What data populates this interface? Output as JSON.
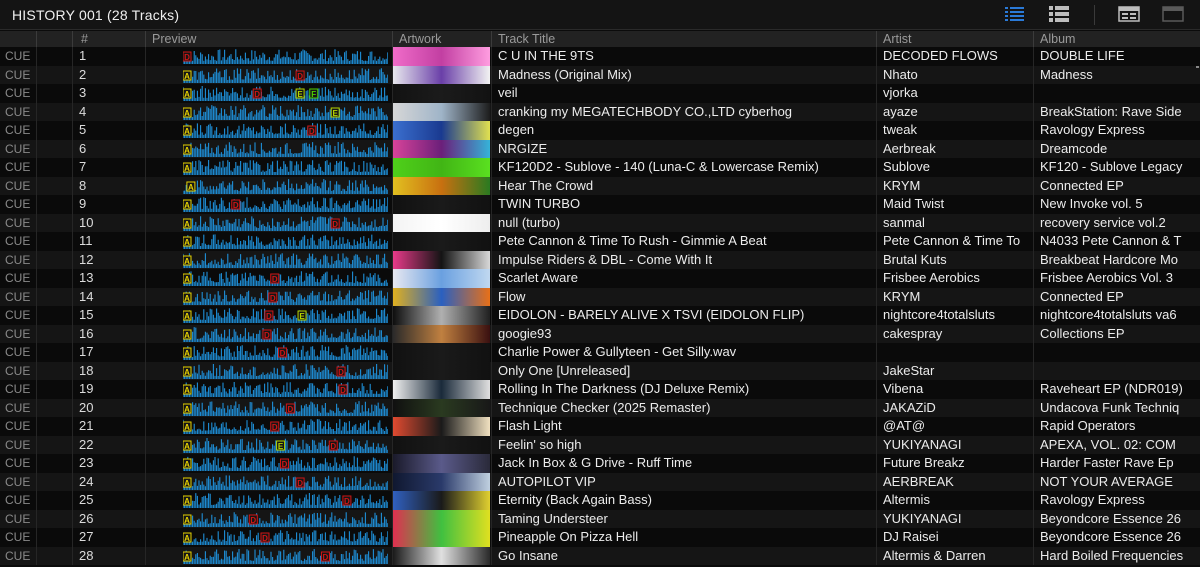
{
  "window": {
    "title": "HISTORY 001 (28 Tracks)"
  },
  "view_buttons": [
    {
      "name": "list-view-icon",
      "active": true
    },
    {
      "name": "detail-list-view-icon",
      "active": false
    },
    {
      "name": "artwork-view-icon",
      "active": false
    },
    {
      "name": "browser-view-icon",
      "active": false
    }
  ],
  "columns": {
    "cue": "",
    "num": "#",
    "preview": "Preview",
    "artwork": "Artwork",
    "title": "Track Title",
    "artist": "Artist",
    "album": "Album"
  },
  "colors": {
    "wave": "#1e8fd8",
    "wave_dim": "#0f4f7d",
    "marker_a": "#e6d200",
    "marker_d": "#d01515",
    "marker_e": "#b6d500",
    "marker_f": "#4ed000"
  },
  "tracks": [
    {
      "cue": "CUE",
      "num": "1",
      "title": "C U IN THE 9TS",
      "artist": "DECODED FLOWS",
      "album": "DOUBLE LIFE",
      "art": [
        "#f06cc9",
        "#c23fa2",
        "#ff9de0"
      ]
    },
    {
      "cue": "CUE",
      "num": "2",
      "title": "Madness  (Original Mix)",
      "artist": "Nhato",
      "album": "Madness",
      "art": [
        "#e8e8ee",
        "#6a3fa8",
        "#f2f2f2"
      ]
    },
    {
      "cue": "CUE",
      "num": "3",
      "title": "veil",
      "artist": "vjorka",
      "album": "",
      "art": [
        "#121212",
        "#1b1b1b",
        "#121212"
      ]
    },
    {
      "cue": "CUE",
      "num": "4",
      "title": "cranking my MEGATECHBODY CO.,LTD cyberhog",
      "artist": "ayaze",
      "album": "BreakStation: Rave Side",
      "art": [
        "#d7d7d7",
        "#9fb4c8",
        "#1d1d1d"
      ]
    },
    {
      "cue": "CUE",
      "num": "5",
      "title": "degen",
      "artist": "tweak",
      "album": "Ravology Express",
      "art": [
        "#3b6fcf",
        "#1a3a90",
        "#e0e050"
      ]
    },
    {
      "cue": "CUE",
      "num": "6",
      "title": "NRGIZE",
      "artist": "Aerbreak",
      "album": "Dreamcode",
      "art": [
        "#d8439a",
        "#6b1f7a",
        "#35b3d9"
      ]
    },
    {
      "cue": "CUE",
      "num": "7",
      "title": "KF120D2 - Sublove - 140 (Luna-C & Lowercase Remix)",
      "artist": "Sublove",
      "album": "KF120 - Sublove Legacy",
      "art": [
        "#4fd01a",
        "#41b515",
        "#5ae020"
      ]
    },
    {
      "cue": "CUE",
      "num": "8",
      "title": "Hear The Crowd",
      "artist": "KRYM",
      "album": "Connected EP",
      "art": [
        "#e2c020",
        "#c87010",
        "#2a7a20"
      ]
    },
    {
      "cue": "CUE",
      "num": "9",
      "title": "TWIN TURBO",
      "artist": "Maid Twist",
      "album": "New Invoke vol. 5",
      "art": [
        "#111111",
        "#1a1a1a",
        "#111111"
      ]
    },
    {
      "cue": "CUE",
      "num": "10",
      "title": "null (turbo)",
      "artist": "sanmal",
      "album": "recovery service vol.2",
      "art": [
        "#f4f4f4",
        "#ffffff",
        "#eeeeee"
      ]
    },
    {
      "cue": "CUE",
      "num": "11",
      "title": "Pete Cannon & Time To Rush - Gimmie A Beat",
      "artist": "Pete Cannon & Time To",
      "album": "N4033 Pete Cannon & T",
      "art": [
        "#111111",
        "#1a1a1a",
        "#111111"
      ]
    },
    {
      "cue": "CUE",
      "num": "12",
      "title": "Impulse Riders & DBL - Come With It",
      "artist": "Brutal Kuts",
      "album": "Breakbeat Hardcore Mo",
      "art": [
        "#e83a8a",
        "#141414",
        "#d8d8d8"
      ]
    },
    {
      "cue": "CUE",
      "num": "13",
      "title": "Scarlet Aware",
      "artist": "Frisbee Aerobics",
      "album": "Frisbee Aerobics Vol. 3",
      "art": [
        "#e8e8f0",
        "#6aa0e0",
        "#c0d8f0"
      ]
    },
    {
      "cue": "CUE",
      "num": "14",
      "title": "Flow",
      "artist": "KRYM",
      "album": "Connected EP",
      "art": [
        "#e0b020",
        "#2a60c0",
        "#e87018"
      ]
    },
    {
      "cue": "CUE",
      "num": "15",
      "title": "EIDOLON - BARELY ALIVE X TSVI (EIDOLON FLIP)",
      "artist": "nightcore4totalsluts",
      "album": "nightcore4totalsluts va6",
      "art": [
        "#0e0e0e",
        "#b0b0b0",
        "#202020"
      ]
    },
    {
      "cue": "CUE",
      "num": "16",
      "title": "googie93",
      "artist": "cakespray",
      "album": "Collections EP",
      "art": [
        "#2a2a2a",
        "#c08040",
        "#3a1010"
      ]
    },
    {
      "cue": "CUE",
      "num": "17",
      "title": "Charlie Power & Gullyteen - Get Silly.wav",
      "artist": "",
      "album": "",
      "art": [
        "#111111",
        "#1a1a1a",
        "#111111"
      ]
    },
    {
      "cue": "CUE",
      "num": "18",
      "title": "Only One [Unreleased]",
      "artist": "JakeStar",
      "album": "",
      "art": [
        "#111111",
        "#1a1a1a",
        "#111111"
      ]
    },
    {
      "cue": "CUE",
      "num": "19",
      "title": "Rolling In The Darkness (DJ Deluxe Remix)",
      "artist": "Vibena",
      "album": "Raveheart EP (NDR019)",
      "art": [
        "#f0f0f0",
        "#1a2a3a",
        "#e0e0e0"
      ]
    },
    {
      "cue": "CUE",
      "num": "20",
      "title": "Technique Checker (2025 Remaster)",
      "artist": "JAKAZiD",
      "album": "Undacova Funk Techniq",
      "art": [
        "#101010",
        "#2a3a20",
        "#181818"
      ]
    },
    {
      "cue": "CUE",
      "num": "21",
      "title": "Flash Light",
      "artist": "@AT@",
      "album": "Rapid Operators",
      "art": [
        "#e04a30",
        "#1a1a1a",
        "#f0e0c0"
      ]
    },
    {
      "cue": "CUE",
      "num": "22",
      "title": "Feelin' so high",
      "artist": "YUKIYANAGI",
      "album": "APEXA, VOL. 02: COM",
      "art": [
        "#111111",
        "#1a1a1a",
        "#111111"
      ]
    },
    {
      "cue": "CUE",
      "num": "23",
      "title": "Jack In Box & G Drive - Ruff Time",
      "artist": "Future Breakz",
      "album": "Harder Faster Rave Ep",
      "art": [
        "#1a1a2a",
        "#5a5a8a",
        "#2a2a3a"
      ]
    },
    {
      "cue": "CUE",
      "num": "24",
      "title": "AUTOPILOT VIP",
      "artist": "AERBREAK",
      "album": "NOT YOUR AVERAGE",
      "art": [
        "#101830",
        "#2a3a6a",
        "#c0d0e0"
      ]
    },
    {
      "cue": "CUE",
      "num": "25",
      "title": "Eternity (Back Again Bass)",
      "artist": "Altermis",
      "album": "Ravology Express",
      "art": [
        "#3060c0",
        "#1a1a1a",
        "#e0d030"
      ]
    },
    {
      "cue": "CUE",
      "num": "26",
      "title": "Taming Understeer",
      "artist": "YUKIYANAGI",
      "album": "Beyondcore Essence 26",
      "art": [
        "#e03050",
        "#40c040",
        "#e0e020"
      ]
    },
    {
      "cue": "CUE",
      "num": "27",
      "title": "Pineapple On Pizza Hell",
      "artist": "DJ Raisei",
      "album": "Beyondcore Essence 26",
      "art": [
        "#e03050",
        "#40c040",
        "#e0e020"
      ]
    },
    {
      "cue": "CUE",
      "num": "28",
      "title": "Go Insane",
      "artist": "Altermis & Darren",
      "album": "Hard Boiled Frequencies",
      "art": [
        "#1a1a1a",
        "#e0e0e0",
        "#2a2a2a"
      ]
    }
  ],
  "markers": [
    [
      [
        "A",
        0.0
      ],
      [
        "D",
        0.0
      ]
    ],
    [
      [
        "A",
        0.0
      ],
      [
        "D",
        0.58
      ]
    ],
    [
      [
        "A",
        0.0
      ],
      [
        "D",
        0.36
      ],
      [
        "E",
        0.58
      ],
      [
        "F",
        0.65
      ]
    ],
    [
      [
        "A",
        0.0
      ],
      [
        "E",
        0.76
      ]
    ],
    [
      [
        "A",
        0.0
      ],
      [
        "D",
        0.64
      ]
    ],
    [
      [
        "A",
        0.0
      ]
    ],
    [
      [
        "A",
        0.0
      ]
    ],
    [
      [
        "A",
        0.02
      ]
    ],
    [
      [
        "A",
        0.0
      ],
      [
        "D",
        0.25
      ]
    ],
    [
      [
        "A",
        0.0
      ],
      [
        "D",
        0.76
      ]
    ],
    [
      [
        "A",
        0.0
      ]
    ],
    [
      [
        "A",
        0.0
      ]
    ],
    [
      [
        "A",
        0.0
      ],
      [
        "D",
        0.45
      ]
    ],
    [
      [
        "A",
        0.0
      ],
      [
        "D",
        0.44
      ]
    ],
    [
      [
        "A",
        0.0
      ],
      [
        "D",
        0.42
      ],
      [
        "E",
        0.59
      ]
    ],
    [
      [
        "A",
        0.0
      ],
      [
        "D",
        0.41
      ]
    ],
    [
      [
        "A",
        0.0
      ],
      [
        "D",
        0.49
      ]
    ],
    [
      [
        "A",
        0.0
      ],
      [
        "D",
        0.79
      ]
    ],
    [
      [
        "A",
        0.0
      ],
      [
        "D",
        0.8
      ]
    ],
    [
      [
        "A",
        0.0
      ],
      [
        "D",
        0.53
      ]
    ],
    [
      [
        "A",
        0.0
      ],
      [
        "D",
        0.45
      ]
    ],
    [
      [
        "A",
        0.0
      ],
      [
        "E",
        0.48
      ],
      [
        "D",
        0.75
      ]
    ],
    [
      [
        "A",
        0.0
      ],
      [
        "D",
        0.5
      ]
    ],
    [
      [
        "A",
        0.0
      ],
      [
        "D",
        0.58
      ]
    ],
    [
      [
        "A",
        0.0
      ],
      [
        "D",
        0.82
      ]
    ],
    [
      [
        "A",
        0.0
      ],
      [
        "D",
        0.34
      ]
    ],
    [
      [
        "A",
        0.0
      ],
      [
        "D",
        0.4
      ]
    ],
    [
      [
        "A",
        0.0
      ],
      [
        "D",
        0.71
      ]
    ]
  ]
}
